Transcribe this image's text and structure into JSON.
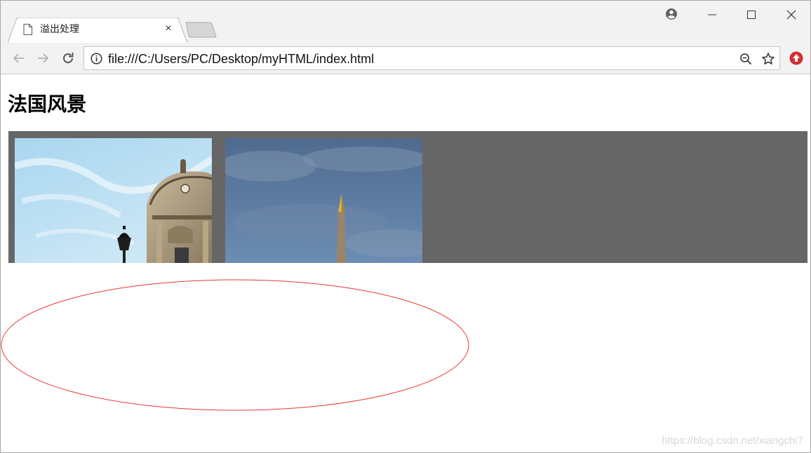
{
  "browser": {
    "tab": {
      "title": "溢出处理",
      "close_glyph": "×"
    },
    "address_bar": {
      "url": "file:///C:/Users/PC/Desktop/myHTML/index.html"
    },
    "icons": {
      "account": "account-circle-icon",
      "minimize": "minimize-icon",
      "maximize": "maximize-icon",
      "close": "close-icon",
      "back": "back-arrow-icon",
      "forward": "forward-arrow-icon",
      "reload": "reload-icon",
      "info": "info-icon",
      "zoom": "zoom-out-icon",
      "bookmark": "star-icon",
      "extension": "extension-icon"
    }
  },
  "page": {
    "heading": "法国风景",
    "gallery": {
      "background": "#666666",
      "photos": [
        {
          "subject": "opera-building-with-street-lamp"
        },
        {
          "subject": "obelisk-under-blue-sky"
        }
      ]
    },
    "annotation_color": "#e53935"
  },
  "watermark": "https://blog.csdn.net/xiangchi7"
}
